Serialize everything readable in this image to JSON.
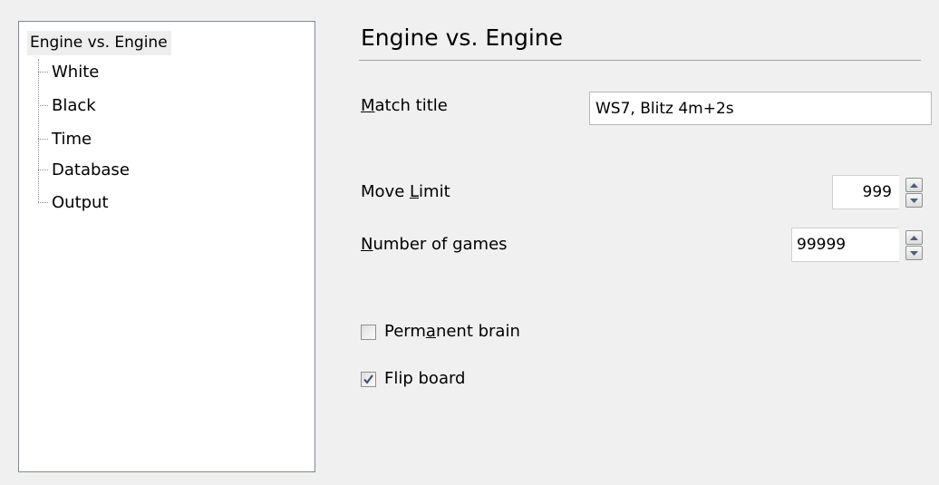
{
  "tree": {
    "root": "Engine vs. Engine",
    "items": [
      "White",
      "Black",
      "Time",
      "Database",
      "Output"
    ]
  },
  "section": {
    "title": "Engine vs. Engine"
  },
  "match_title": {
    "label_mnemonic": "M",
    "label_rest": "atch title",
    "value": "WS7, Blitz 4m+2s"
  },
  "move_limit": {
    "label_pre": "Move ",
    "label_mnemonic": "L",
    "label_rest": "imit",
    "value": "999"
  },
  "number_of_games": {
    "label_mnemonic": "N",
    "label_rest": "umber of games",
    "value": "99999"
  },
  "permanent_brain": {
    "label_pre": "Perm",
    "label_mnemonic": "a",
    "label_rest": "nent brain",
    "checked": false
  },
  "flip_board": {
    "label": "Flip board",
    "checked": true
  },
  "icons": {
    "spin_up": "spin-up-arrow-icon",
    "spin_down": "spin-down-arrow-icon",
    "check": "check-mark-icon"
  }
}
